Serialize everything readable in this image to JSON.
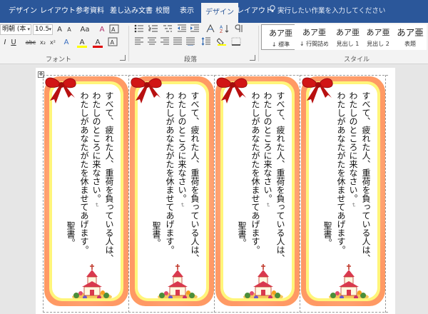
{
  "tabs": [
    "デザイン",
    "レイアウト",
    "参考資料",
    "差し込み文書",
    "校閲",
    "表示",
    "デザイン",
    "レイアウト"
  ],
  "active_tab_index": 6,
  "tell_me": "実行したい作業を入力してください",
  "ribbon": {
    "font_name": "明朝 (本",
    "font_size": "10.5",
    "group_font": "フォント",
    "group_paragraph": "段落",
    "group_style": "スタイル",
    "styles": [
      {
        "sample": "あア亜",
        "name": "↓ 標準"
      },
      {
        "sample": "あア亜",
        "name": "↓ 行間詰め"
      },
      {
        "sample": "あア亜",
        "name": "見出し 1"
      },
      {
        "sample": "あア亜",
        "name": "見出し 2"
      },
      {
        "sample": "あア亜",
        "name": "表題"
      }
    ],
    "buttons_row1": [
      "A",
      "A",
      "Aa",
      "A"
    ],
    "buttons_row2": [
      "I",
      "U",
      "abc",
      "x₂",
      "x²",
      "A",
      "A",
      "A"
    ]
  },
  "bookmark": {
    "lines": [
      "すべて、疲れた人、重荷を負っている人は、",
      "わたしのところに来なさい。",
      "わたしがあなたがたを休ませてあげます。"
    ],
    "source": "聖書。",
    "return_mark": "↵"
  },
  "colors": {
    "tab_bar": "#2b579a",
    "border_outer": "#ff9966",
    "border_yellow": "#fff57a",
    "ribbon_red": "#d11515"
  }
}
